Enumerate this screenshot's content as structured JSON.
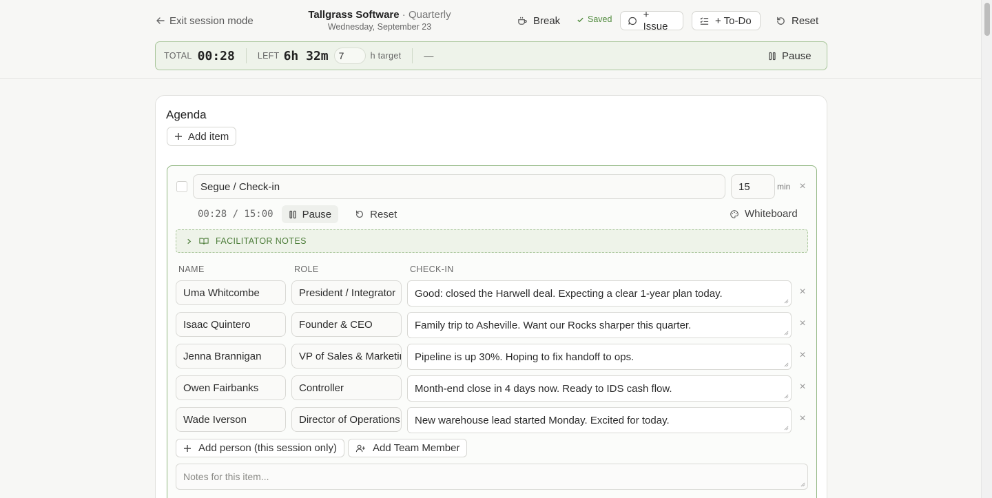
{
  "header": {
    "exit_label": "Exit session mode",
    "company": "Tallgrass Software",
    "session_type": "· Quarterly",
    "date": "Wednesday, September 23",
    "break_label": "Break",
    "saved_label": "Saved",
    "issue_label": "+ Issue",
    "todo_label": "+ To-Do",
    "reset_label": "Reset"
  },
  "timerbar": {
    "total_label": "TOTAL",
    "total_value": "00:28",
    "left_label": "LEFT",
    "left_value": "6h 32m",
    "target_value": "7",
    "target_label": "h target",
    "dash": "—",
    "pause_label": "Pause"
  },
  "agenda": {
    "title": "Agenda",
    "add_item_label": "Add item",
    "item": {
      "title": "Segue / Check-in",
      "minutes": "15",
      "min_label": "min",
      "timer": "00:28 / 15:00",
      "pause_label": "Pause",
      "reset_label": "Reset",
      "whiteboard_label": "Whiteboard",
      "facilitator_label": "FACILITATOR NOTES",
      "columns": {
        "name": "NAME",
        "role": "ROLE",
        "checkin": "CHECK-IN"
      },
      "rows": [
        {
          "name": "Uma Whitcombe",
          "role": "President / Integrator",
          "checkin": "Good: closed the Harwell deal. Expecting a clear 1-year plan today."
        },
        {
          "name": "Isaac Quintero",
          "role": "Founder & CEO",
          "checkin": "Family trip to Asheville. Want our Rocks sharper this quarter."
        },
        {
          "name": "Jenna Brannigan",
          "role": "VP of Sales & Marketing",
          "checkin": "Pipeline is up 30%. Hoping to fix handoff to ops."
        },
        {
          "name": "Owen Fairbanks",
          "role": "Controller",
          "checkin": "Month-end close in 4 days now. Ready to IDS cash flow."
        },
        {
          "name": "Wade Iverson",
          "role": "Director of Operations",
          "checkin": "New warehouse lead started Monday. Excited for today."
        }
      ],
      "add_person_label": "Add person (this session only)",
      "add_member_label": "Add Team Member",
      "notes_placeholder": "Notes for this item..."
    }
  }
}
